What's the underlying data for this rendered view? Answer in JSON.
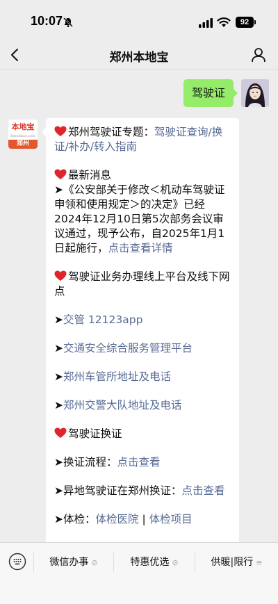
{
  "status_bar": {
    "time": "10:07",
    "battery": "92"
  },
  "nav": {
    "title": "郑州本地宝"
  },
  "sent": {
    "text": "驾驶证"
  },
  "bot": {
    "logo_text": "本地宝",
    "logo_sub": "Bendibao.com",
    "logo_city": "郑州"
  },
  "message": {
    "p1_prefix": "郑州驾驶证专题：",
    "p1_link": "驾驶证查询/换证/补办/转入指南",
    "p2_title": "最新消息",
    "p2_body": "《公安部关于修改＜机动车驾驶证申领和使用规定＞的决定》已经2024年12月10日第5次部务会议审议通过，现予公布，自2025年1月1日起施行，",
    "p2_link": "点击查看详情",
    "p3_title": "驾驶证业务办理线上平台及线下网点",
    "link_12123": "交管 12123app",
    "link_platform": "交通安全综合服务管理平台",
    "link_dmv": "郑州车管所地址及电话",
    "link_police": "郑州交警大队地址及电话",
    "p4_title": "驾驶证换证",
    "renew_label": "换证流程：",
    "renew_link": "点击查看",
    "remote_label": "异地驾驶证在郑州换证：",
    "remote_link": "点击查看",
    "exam_label": "体检：",
    "exam_link1": "体检医院",
    "exam_sep": "|",
    "exam_link2": "体检项目"
  },
  "menu": {
    "item1": "微信办事",
    "item2": "特惠优选",
    "item3": "供暖|限行"
  },
  "colors": {
    "link": "#576b95",
    "sent_bubble": "#95ec69",
    "heart": "#e0242b"
  }
}
